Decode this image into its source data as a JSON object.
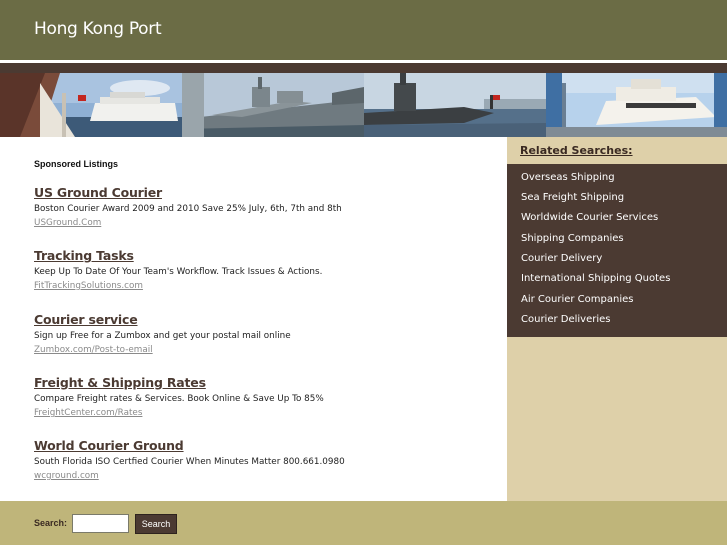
{
  "header": {
    "title": "Hong Kong Port"
  },
  "banner": {
    "images": [
      {
        "name": "harbor-cruise-ship-photo"
      },
      {
        "name": "naval-warship-photo"
      },
      {
        "name": "submarine-dock-photo"
      },
      {
        "name": "yacht-marina-photo"
      }
    ]
  },
  "main": {
    "sponsored_heading": "Sponsored Listings",
    "listings": [
      {
        "title": "US Ground Courier",
        "description": "Boston Courier Award 2009 and 2010 Save 25% July, 6th, 7th and 8th",
        "url": "USGround.Com"
      },
      {
        "title": "Tracking Tasks",
        "description": "Keep Up To Date Of Your Team's Workflow. Track Issues & Actions.",
        "url": "FitTrackingSolutions.com"
      },
      {
        "title": "Courier service",
        "description": "Sign up Free for a Zumbox and get your postal mail online",
        "url": "Zumbox.com/Post-to-email"
      },
      {
        "title": "Freight & Shipping Rates",
        "description": "Compare Freight rates & Services. Book Online & Save Up To 85%",
        "url": "FreightCenter.com/Rates"
      },
      {
        "title": "World Courier Ground",
        "description": "South Florida ISO Certfied Courier When Minutes Matter 800.661.0980",
        "url": "wcground.com"
      }
    ]
  },
  "sidebar": {
    "heading": "Related Searches:",
    "links": [
      "Overseas Shipping",
      "Sea Freight Shipping",
      "Worldwide Courier Services",
      "Shipping Companies",
      "Courier Delivery",
      "International Shipping Quotes",
      "Air Courier Companies",
      "Courier Deliveries"
    ]
  },
  "footer": {
    "search_label": "Search:",
    "search_value": "",
    "search_button": "Search"
  },
  "colors": {
    "header_bg": "#6b6c45",
    "brown": "#4b3a32",
    "sidebar_bg": "#ded0a9",
    "footer_bg": "#bfb57a"
  }
}
